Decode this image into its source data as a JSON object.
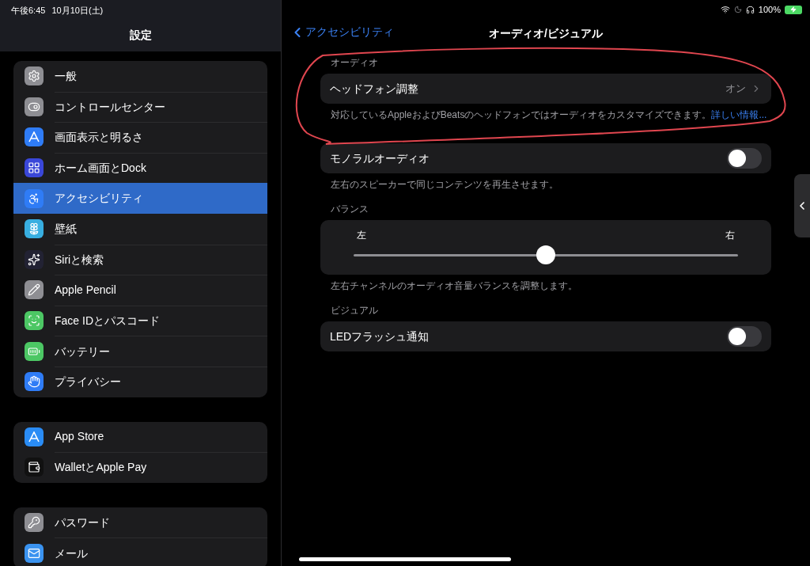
{
  "status_bar": {
    "time": "午後6:45",
    "date": "10月10日(土)",
    "battery": "100%"
  },
  "sidebar": {
    "title": "設定",
    "groups": [
      {
        "items": [
          {
            "label": "一般",
            "color": "#8e8e93",
            "selected": false
          },
          {
            "label": "コントロールセンター",
            "color": "#8e8e93",
            "selected": false
          },
          {
            "label": "画面表示と明るさ",
            "color": "#2f7cf6",
            "selected": false
          },
          {
            "label": "ホーム画面とDock",
            "color": "#3a47d9",
            "selected": false
          },
          {
            "label": "アクセシビリティ",
            "color": "#2f7cf6",
            "selected": true
          },
          {
            "label": "壁紙",
            "color": "#38aee0",
            "selected": false
          },
          {
            "label": "Siriと検索",
            "color": "#222233",
            "selected": false
          },
          {
            "label": "Apple Pencil",
            "color": "#8e8e93",
            "selected": false
          },
          {
            "label": "Face IDとパスコード",
            "color": "#4cc764",
            "selected": false
          },
          {
            "label": "バッテリー",
            "color": "#4cc764",
            "selected": false
          },
          {
            "label": "プライバシー",
            "color": "#2f7cf6",
            "selected": false
          }
        ]
      },
      {
        "items": [
          {
            "label": "App Store",
            "color": "#2a8cf5",
            "selected": false
          },
          {
            "label": "WalletとApple Pay",
            "color": "#111111",
            "selected": false
          }
        ]
      },
      {
        "items": [
          {
            "label": "パスワード",
            "color": "#8e8e93",
            "selected": false
          },
          {
            "label": "メール",
            "color": "#3a93f0",
            "selected": false
          }
        ]
      }
    ]
  },
  "detail": {
    "back": "アクセシビリティ",
    "title": "オーディオ/ビジュアル",
    "sections": [
      {
        "header": "オーディオ",
        "rows": [
          {
            "kind": "link",
            "label": "ヘッドフォン調整",
            "value": "オン"
          }
        ],
        "footer": "対応しているAppleおよびBeatsのヘッドフォンではオーディオをカスタマイズできます。",
        "footer_link": "詳しい情報..."
      },
      {
        "rows": [
          {
            "kind": "toggle",
            "label": "モノラルオーディオ",
            "on": false
          }
        ],
        "footer": "左右のスピーカーで同じコンテンツを再生させます。"
      },
      {
        "header": "バランス",
        "rows": [
          {
            "kind": "slider",
            "left": "左",
            "right": "右",
            "level": 0.5
          }
        ],
        "footer": "左右チャンネルのオーディオ音量バランスを調整します。"
      },
      {
        "header": "ビジュアル",
        "rows": [
          {
            "kind": "toggle",
            "label": "LEDフラッシュ通知",
            "on": false
          }
        ]
      }
    ]
  }
}
